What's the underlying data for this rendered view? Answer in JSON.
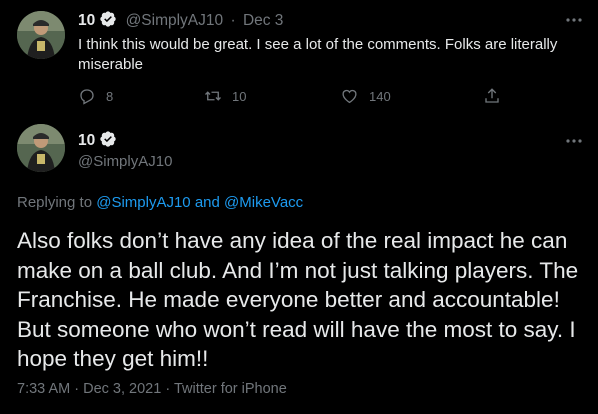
{
  "reply_context_tweet": {
    "author_name": "10",
    "handle": "@SimplyAJ10",
    "separator": "·",
    "date": "Dec 3",
    "text": "I think this would be great. I see a lot of the comments. Folks are literally miserable",
    "replies": "8",
    "retweets": "10",
    "likes": "140"
  },
  "main_tweet": {
    "author_name": "10",
    "handle": "@SimplyAJ10",
    "replying_prefix": "Replying to",
    "replying_user_1": "@SimplyAJ10",
    "replying_and": "and",
    "replying_user_2": "@MikeVacc",
    "text": "Also folks don’t have any idea of the real impact he can make on a ball club. And I’m not just talking players. The Franchise. He made everyone better and accountable!  But someone who won’t read will have the most to say. I hope they get him!!",
    "time": "7:33 AM",
    "separator": "·",
    "date": "Dec 3, 2021",
    "separator_2": "·",
    "source": "Twitter for iPhone"
  },
  "colors": {
    "background": "#000000",
    "text": "#e7e9ea",
    "muted": "#71767b",
    "link": "#1d9bf0"
  },
  "icons": {
    "verified": "verified-badge-icon",
    "more": "more-dots-icon",
    "reply": "reply-bubble-icon",
    "retweet": "retweet-icon",
    "like": "heart-icon",
    "share": "share-upload-icon"
  }
}
